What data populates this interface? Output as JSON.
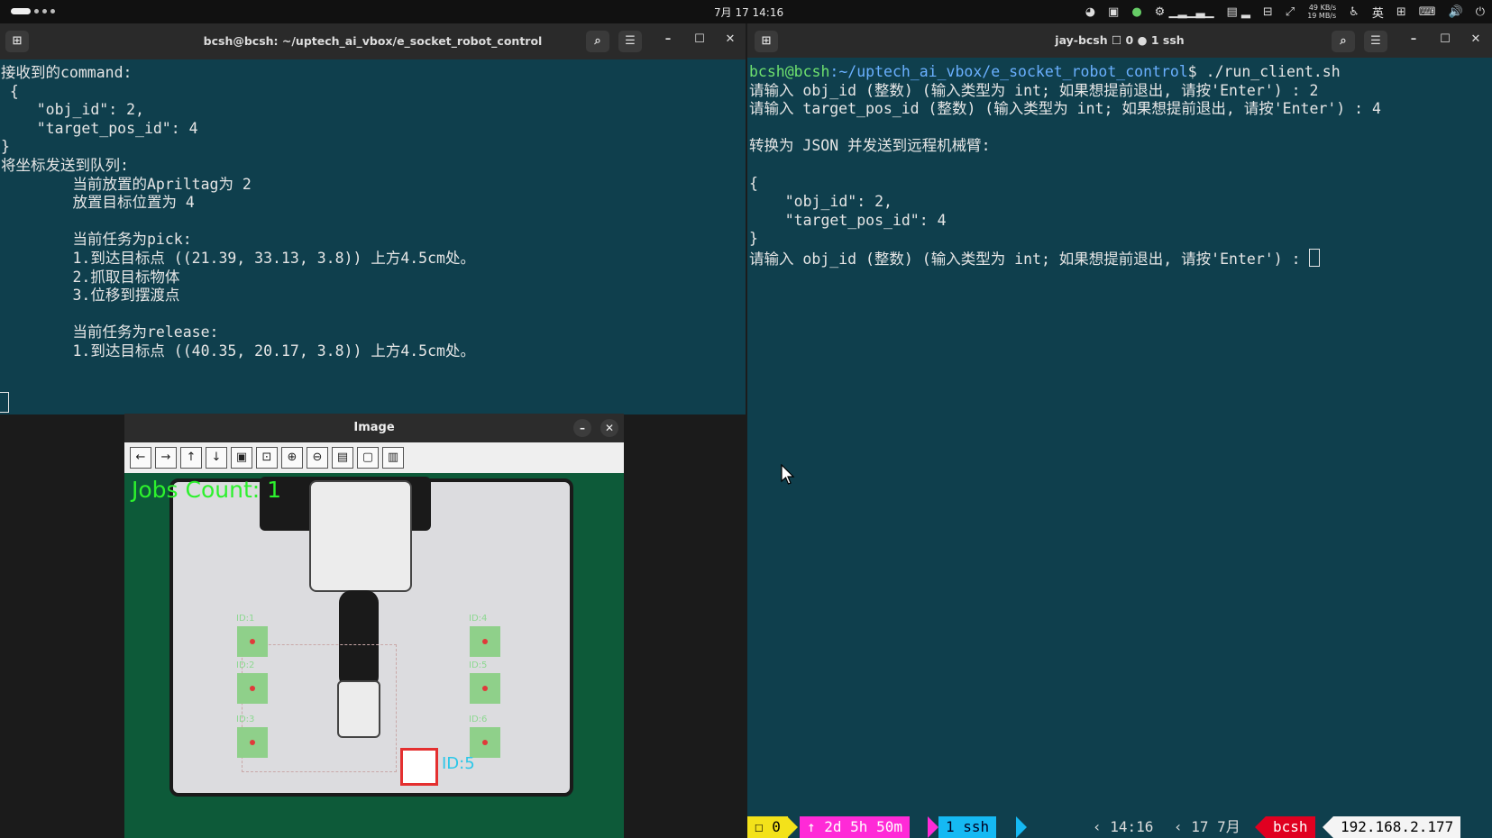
{
  "topbar": {
    "clock": "7月 17  14:16",
    "net_up": "49 KB/s",
    "net_down": "19 MB/s",
    "ime": "英"
  },
  "left_terminal": {
    "title": "bcsh@bcsh: ~/uptech_ai_vbox/e_socket_robot_control",
    "lines": [
      "接收到的command:",
      " {",
      "    \"obj_id\": 2,",
      "    \"target_pos_id\": 4",
      "}",
      "将坐标发送到队列:",
      "        当前放置的Apriltag为 2",
      "        放置目标位置为 4",
      "",
      "        当前任务为pick:",
      "        1.到达目标点 ((21.39, 33.13, 3.8)) 上方4.5cm处。",
      "        2.抓取目标物体",
      "        3.位移到摆渡点",
      "",
      "        当前任务为release:",
      "        1.到达目标点 ((40.35, 20.17, 3.8)) 上方4.5cm处。"
    ]
  },
  "right_terminal": {
    "title": "jay-bcsh ☐ 0 ● 1 ssh",
    "prompt_user": "bcsh@bcsh",
    "prompt_path": ":~/uptech_ai_vbox/e_socket_robot_control",
    "prompt_cmd": "$ ./run_client.sh",
    "lines": [
      "请输入 obj_id (整数) (输入类型为 int; 如果想提前退出, 请按'Enter') : 2",
      "请输入 target_pos_id (整数) (输入类型为 int; 如果想提前退出, 请按'Enter') : 4",
      "",
      "转换为 JSON 并发送到远程机械臂:",
      "",
      "{",
      "    \"obj_id\": 2,",
      "    \"target_pos_id\": 4",
      "}"
    ],
    "last_line": "请输入 obj_id (整数) (输入类型为 int; 如果想提前退出, 请按'Enter') : "
  },
  "statusbar": {
    "window": "☐ 0",
    "uptime": "↑ 2d 5h 50m",
    "session": "1 ssh",
    "time": "14:16",
    "date": "17 7月",
    "host": "bcsh",
    "ip": "192.168.2.177"
  },
  "viewer": {
    "title": "Image",
    "jobs_label": "Jobs Count: 1",
    "tag_label": "ID:5",
    "slot_labels": [
      "ID:1",
      "ID:4",
      "ID:2",
      "ID:5",
      "ID:3",
      "ID:6"
    ]
  }
}
